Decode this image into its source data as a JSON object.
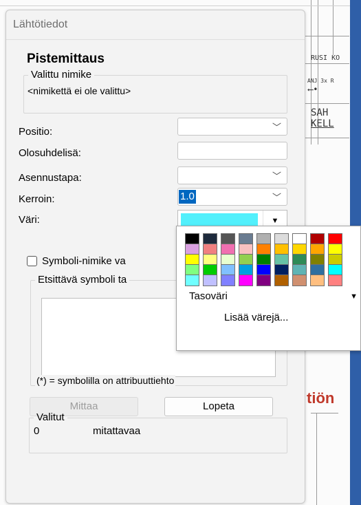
{
  "cad": {
    "labels": [
      "RUSI KO",
      "SAH",
      "KELL",
      "tiön"
    ],
    "arrow_text": "ANJ 3x R"
  },
  "dialog": {
    "title": "Lähtötiedot",
    "heading": "Pistemittaus",
    "selected_item": {
      "legend": "Valittu nimike",
      "value": "<nimikettä ei ole valittu>"
    },
    "fields": {
      "positio_label": "Positio:",
      "olosuhdelisa_label": "Olosuhdelisä:",
      "asennustapa_label": "Asennustapa:",
      "kerroin_label": "Kerroin:",
      "kerroin_value": "1.0",
      "vari_label": "Väri:",
      "vari_value": "#52f0fc"
    },
    "symbol_checkbox_label": "Symboli-nimike va",
    "symbol_search": {
      "legend": "Etsittävä symboli ta",
      "footnote": "(*) = symbolilla on attribuuttiehto"
    },
    "buttons": {
      "mittaa": "Mittaa",
      "lopeta": "Lopeta"
    },
    "selected": {
      "legend": "Valitut",
      "count": "0",
      "unit": "mitattavaa"
    }
  },
  "color_popup": {
    "colors": [
      [
        "#000000",
        "#1d2a3c",
        "#555555",
        "#6a7c91",
        "#b0b0b0",
        "#dcdcdc",
        "#ffffff",
        "#b00000",
        "#ff0000"
      ],
      [
        "#d9a0e0",
        "#f08080",
        "#f06fb0",
        "#f9c0c0",
        "#ff8000",
        "#ffc000",
        "#ffd700",
        "#ffa500",
        "#ffff00"
      ],
      [
        "#ffff00",
        "#ffff80",
        "#e8ffd0",
        "#92d050",
        "#008000",
        "#66c2a5",
        "#2e8b57",
        "#808000",
        "#cccc00"
      ],
      [
        "#80ff80",
        "#00cc00",
        "#80c0ff",
        "#00a0e0",
        "#0000ff",
        "#002060",
        "#5fb4b4",
        "#2f6f9f",
        "#00ffff"
      ],
      [
        "#70ffff",
        "#c0c0ff",
        "#8080ff",
        "#ff00ff",
        "#800080",
        "#b06000",
        "#d09070",
        "#ffbf80",
        "#ff8080"
      ]
    ],
    "layer_color_label": "Tasoväri",
    "more_colors_label": "Lisää värejä..."
  }
}
